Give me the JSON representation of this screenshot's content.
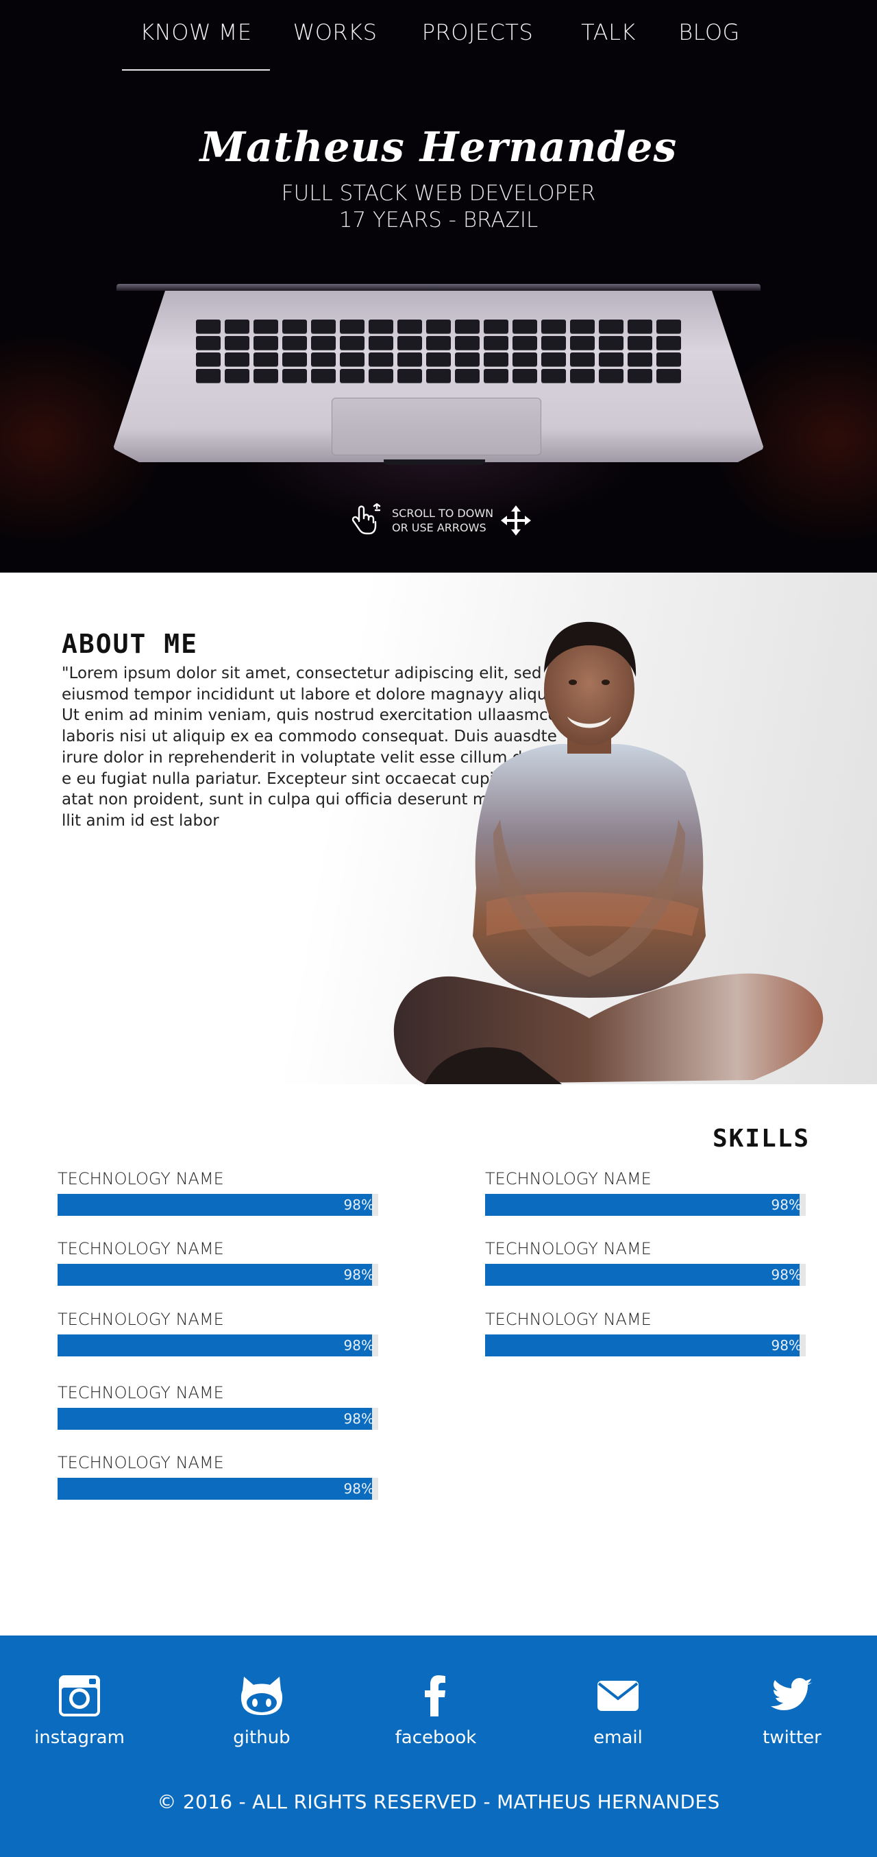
{
  "nav": {
    "items": [
      {
        "label": "KNOW ME",
        "active": true
      },
      {
        "label": "WORKS"
      },
      {
        "label": "PROJECTS"
      },
      {
        "label": "TALK"
      },
      {
        "label": "BLOG"
      }
    ]
  },
  "hero": {
    "name": "Matheus Hernandes",
    "role": "FULL STACK WEB DEVELOPER",
    "age": "17 YEARS - BRAZIL",
    "scroll_line1": "SCROLL TO DOWN",
    "scroll_line2": "OR USE ARROWS",
    "icons": [
      "hand-swipe-icon",
      "move-arrows-icon"
    ]
  },
  "about": {
    "title": "ABOUT ME",
    "lines": [
      "\"Lorem ipsum dolor sit amet, consectetur adipiscing elit, sed do",
      " eiusmod tempor incididunt ut labore et dolore magnayy aliqua.",
      "Ut enim ad minim veniam, quis nostrud exercitation ullaasmco",
      " laboris nisi ut aliquip ex ea commodo consequat. Duis auasdte",
      "irure dolor in reprehenderit in voluptate velit esse cillum dor",
      "e eu fugiat nulla pariatur. Excepteur sint occaecat cupid",
      "atat non proident, sunt in culpa qui officia deserunt mo",
      "llit anim id est labor"
    ]
  },
  "skills": {
    "title": "SKILLS",
    "left": [
      {
        "name": "TECHNOLOGY NAME",
        "percent": 98,
        "label": "98%"
      },
      {
        "name": "TECHNOLOGY NAME",
        "percent": 98,
        "label": "98%"
      },
      {
        "name": "TECHNOLOGY NAME",
        "percent": 98,
        "label": "98%"
      },
      {
        "name": "TECHNOLOGY NAME",
        "percent": 98,
        "label": "98%"
      },
      {
        "name": "TECHNOLOGY NAME",
        "percent": 98,
        "label": "98%"
      }
    ],
    "right": [
      {
        "name": "TECHNOLOGY NAME",
        "percent": 98,
        "label": "98%"
      },
      {
        "name": "TECHNOLOGY NAME",
        "percent": 98,
        "label": "98%"
      },
      {
        "name": "TECHNOLOGY NAME",
        "percent": 98,
        "label": "98%"
      }
    ]
  },
  "footer": {
    "social": [
      {
        "label": "instagram",
        "icon": "instagram-icon"
      },
      {
        "label": "github",
        "icon": "github-icon"
      },
      {
        "label": "facebook",
        "icon": "facebook-icon"
      },
      {
        "label": "email",
        "icon": "email-icon"
      },
      {
        "label": "twitter",
        "icon": "twitter-icon"
      }
    ],
    "copyright": "© 2016 - ALL RIGHTS RESERVED - MATHEUS HERNANDES"
  },
  "colors": {
    "accent": "#0b6cbf",
    "hero_bg": "#050307",
    "text_light": "#f2f2f2"
  }
}
